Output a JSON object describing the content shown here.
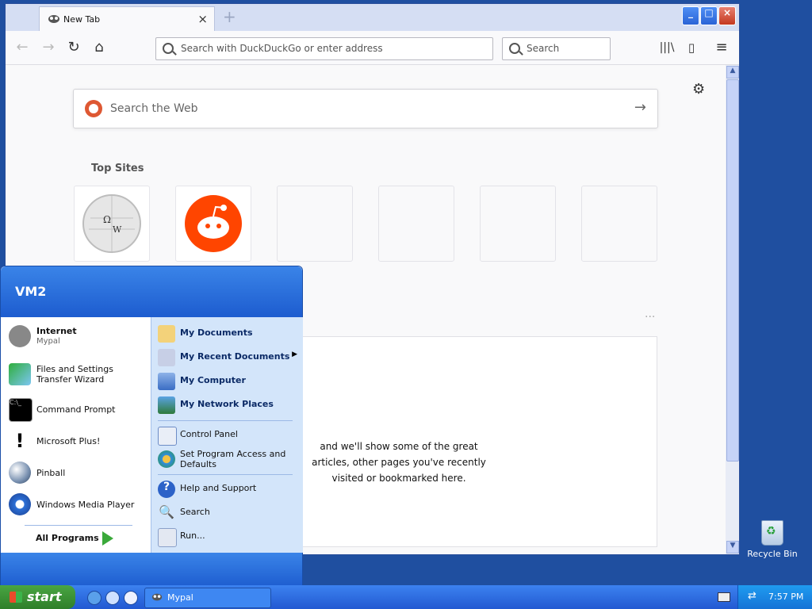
{
  "browser": {
    "tab_title": "New Tab",
    "url_placeholder": "Search with DuckDuckGo or enter address",
    "search_placeholder": "Search",
    "web_search_placeholder": "Search the Web",
    "top_sites_label": "Top Sites",
    "highlight_text": "and we'll show some of the great articles, other pages you've recently visited or bookmarked here."
  },
  "start_menu": {
    "user": "VM2",
    "left_items": [
      {
        "label": "Internet",
        "sublabel": "Mypal"
      },
      {
        "label": "Files and Settings Transfer Wizard"
      },
      {
        "label": "Command Prompt"
      },
      {
        "label": "Microsoft Plus!"
      },
      {
        "label": "Pinball"
      },
      {
        "label": "Windows Media Player"
      }
    ],
    "all_programs": "All Programs",
    "right_items": [
      {
        "label": "My Documents"
      },
      {
        "label": "My Recent Documents"
      },
      {
        "label": "My Computer"
      },
      {
        "label": "My Network Places"
      },
      {
        "label": "Control Panel"
      },
      {
        "label": "Set Program Access and Defaults"
      },
      {
        "label": "Help and Support"
      },
      {
        "label": "Search"
      },
      {
        "label": "Run..."
      }
    ]
  },
  "desktop": {
    "recycle_bin": "Recycle Bin"
  },
  "taskbar": {
    "start_label": "start",
    "active_window": "Mypal",
    "time": "7:57 PM"
  }
}
